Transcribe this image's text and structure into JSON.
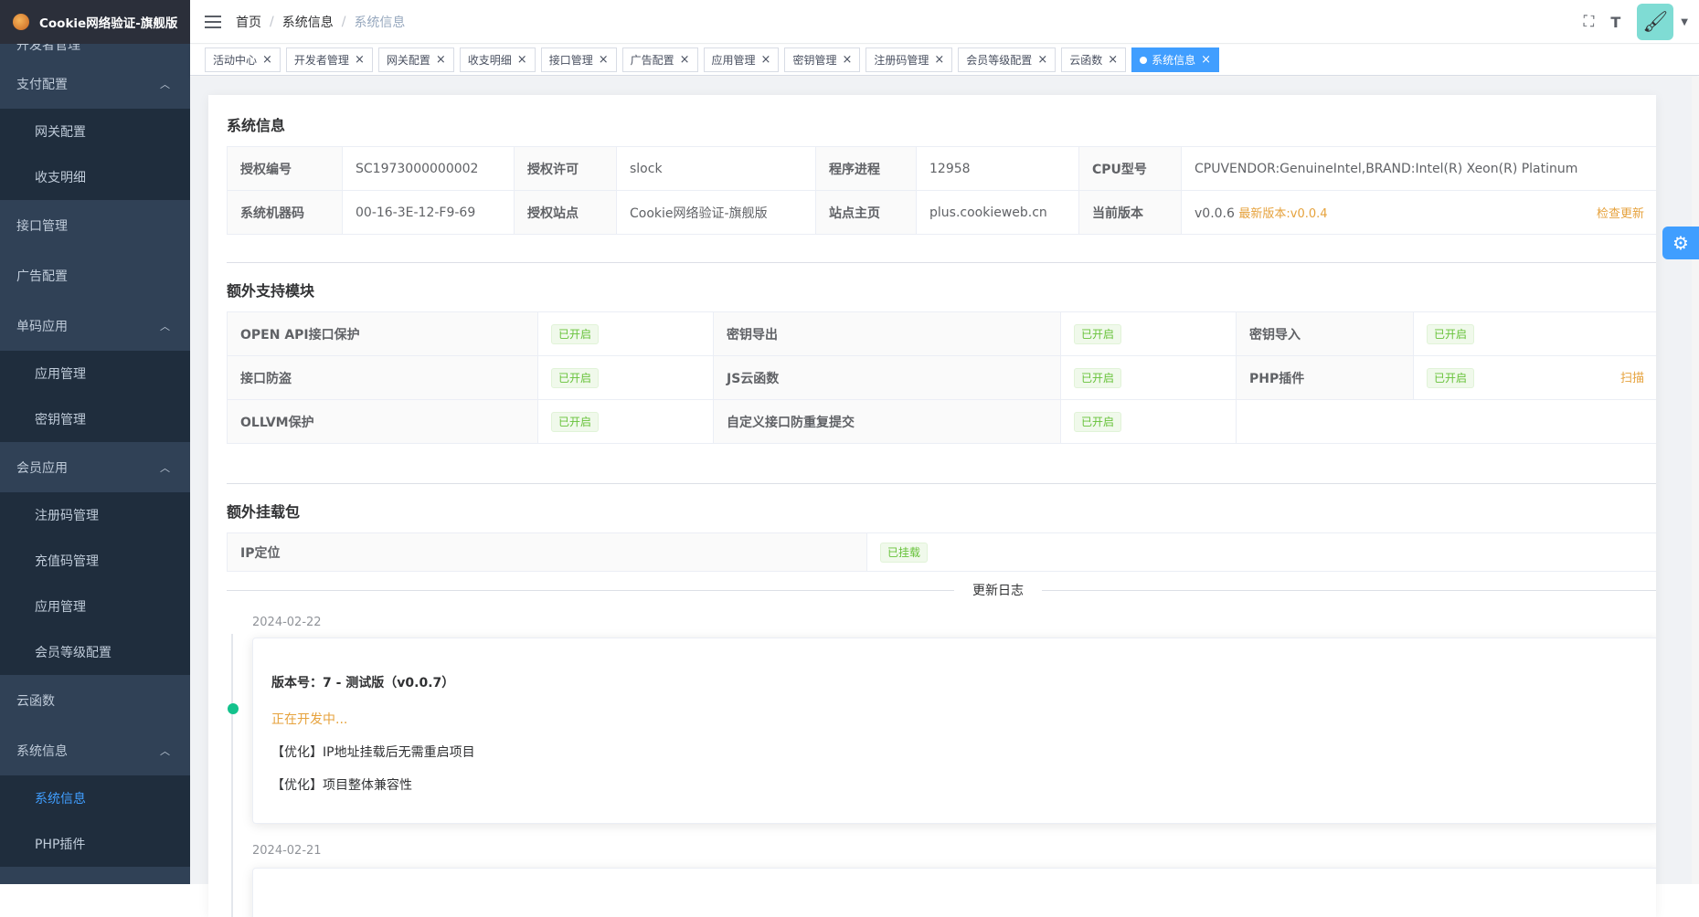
{
  "app": {
    "title": "Cookie网络验证-旗舰版"
  },
  "sidebar": {
    "cut_item": "开发者管理",
    "items": [
      {
        "label": "支付配置",
        "type": "group",
        "expanded": true
      },
      {
        "label": "网关配置",
        "type": "sub"
      },
      {
        "label": "收支明细",
        "type": "sub"
      },
      {
        "label": "接口管理",
        "type": "group"
      },
      {
        "label": "广告配置",
        "type": "group"
      },
      {
        "label": "单码应用",
        "type": "group",
        "expanded": true
      },
      {
        "label": "应用管理",
        "type": "sub"
      },
      {
        "label": "密钥管理",
        "type": "sub"
      },
      {
        "label": "会员应用",
        "type": "group",
        "expanded": true
      },
      {
        "label": "注册码管理",
        "type": "sub"
      },
      {
        "label": "充值码管理",
        "type": "sub"
      },
      {
        "label": "应用管理",
        "type": "sub"
      },
      {
        "label": "会员等级配置",
        "type": "sub"
      },
      {
        "label": "云函数",
        "type": "group"
      },
      {
        "label": "系统信息",
        "type": "group",
        "expanded": true
      },
      {
        "label": "系统信息",
        "type": "sub",
        "active": true
      },
      {
        "label": "PHP插件",
        "type": "sub"
      }
    ]
  },
  "breadcrumb": {
    "items": [
      "首页",
      "系统信息",
      "系统信息"
    ],
    "sep": "/"
  },
  "tags": [
    {
      "label": "活动中心"
    },
    {
      "label": "开发者管理"
    },
    {
      "label": "网关配置"
    },
    {
      "label": "收支明细"
    },
    {
      "label": "接口管理"
    },
    {
      "label": "广告配置"
    },
    {
      "label": "应用管理"
    },
    {
      "label": "密钥管理"
    },
    {
      "label": "注册码管理"
    },
    {
      "label": "会员等级配置"
    },
    {
      "label": "云函数"
    },
    {
      "label": "系统信息",
      "active": true
    }
  ],
  "sysinfo": {
    "title": "系统信息",
    "row1": [
      {
        "label": "授权编号",
        "value": "SC1973000000002"
      },
      {
        "label": "授权许可",
        "value": "slock"
      },
      {
        "label": "程序进程",
        "value": "12958"
      },
      {
        "label": "CPU型号",
        "value": "CPUVENDOR:GenuineIntel,BRAND:Intel(R) Xeon(R) Platinum"
      }
    ],
    "row2": [
      {
        "label": "系统机器码",
        "value": "00-16-3E-12-F9-69"
      },
      {
        "label": "授权站点",
        "value": "Cookie网络验证-旗舰版"
      },
      {
        "label": "站点主页",
        "value": "plus.cookieweb.cn"
      },
      {
        "label": "当前版本",
        "value": "v0.0.6",
        "latest": "最新版本:v0.0.4",
        "action": "检查更新"
      }
    ]
  },
  "modules": {
    "title": "额外支持模块",
    "rows": [
      [
        {
          "label": "OPEN API接口保护",
          "status": "已开启"
        },
        {
          "label": "密钥导出",
          "status": "已开启"
        },
        {
          "label": "密钥导入",
          "status": "已开启"
        }
      ],
      [
        {
          "label": "接口防盗",
          "status": "已开启"
        },
        {
          "label": "JS云函数",
          "status": "已开启"
        },
        {
          "label": "PHP插件",
          "status": "已开启",
          "action": "扫描"
        }
      ],
      [
        {
          "label": "OLLVM保护",
          "status": "已开启"
        },
        {
          "label": "自定义接口防重复提交",
          "status": "已开启"
        }
      ]
    ]
  },
  "packages": {
    "title": "额外挂载包",
    "items": [
      {
        "label": "IP定位",
        "status": "已挂载"
      }
    ]
  },
  "changelog": {
    "title": "更新日志",
    "entries": [
      {
        "date": "2024-02-22",
        "version": "版本号：7 - 测试版（v0.0.7）",
        "state": "正在开发中...",
        "lines": [
          "【优化】IP地址挂载后无需重启项目",
          "【优化】项目整体兼容性"
        ]
      },
      {
        "date": "2024-02-21"
      }
    ]
  },
  "colors": {
    "sidebar": "#304156",
    "sidebar_sub": "#1f2d3d",
    "accent": "#409eff",
    "success": "#67c23a",
    "warning": "#e6a23c",
    "timeline_dot": "#13c28c"
  }
}
